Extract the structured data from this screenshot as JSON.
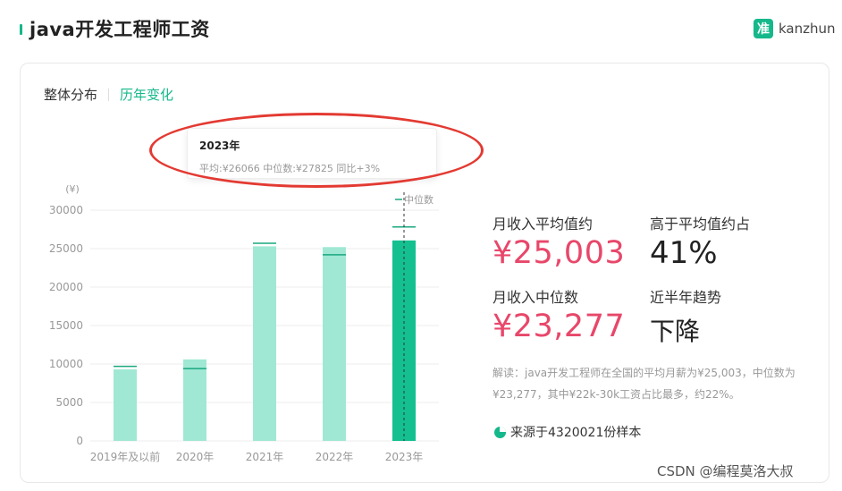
{
  "header": {
    "title": "java开发工程师工资",
    "logo_mark": "准",
    "logo_text": "kanzhun"
  },
  "tabs": [
    {
      "label": "整体分布",
      "active": false
    },
    {
      "label": "历年变化",
      "active": true
    }
  ],
  "tooltip": {
    "title": "2023年",
    "body": "平均:¥26066  中位数:¥27825  同比+3%"
  },
  "chart_data": {
    "type": "bar",
    "ylabel": "(¥)",
    "ylim": [
      0,
      30000
    ],
    "yticks": [
      0,
      5000,
      10000,
      15000,
      20000,
      25000,
      30000
    ],
    "categories": [
      "2019年及以前",
      "2020年",
      "2021年",
      "2022年",
      "2023年"
    ],
    "series": [
      {
        "values": [
          9300,
          10600,
          25300,
          25200,
          26066
        ]
      },
      {
        "values": [
          9700,
          9400,
          25700,
          24200,
          27825
        ]
      }
    ],
    "legend": [
      {
        "label": "中位数",
        "placement": "top-right"
      }
    ],
    "highlighted_index": 4,
    "grid": true,
    "colors": {
      "bar": "#a0e8d4",
      "bar_active": "#14c08f",
      "median_line": "#1aa87f",
      "grid": "#ececec",
      "tick": "#999999"
    }
  },
  "stats": {
    "avg_label": "月收入平均值约",
    "avg_value": "¥25,003",
    "above_avg_label": "高于平均值约占",
    "above_avg_value": "41%",
    "median_label": "月收入中位数",
    "median_value": "¥23,277",
    "trend_label": "近半年趋势",
    "trend_value": "下降"
  },
  "description": "解读：java开发工程师在全国的平均月薪为¥25,003，中位数为¥23,277，其中¥22k-30k工资占比最多，约22%。",
  "source": "来源于4320021份样本",
  "watermark": "CSDN @编程莫洛大叔"
}
